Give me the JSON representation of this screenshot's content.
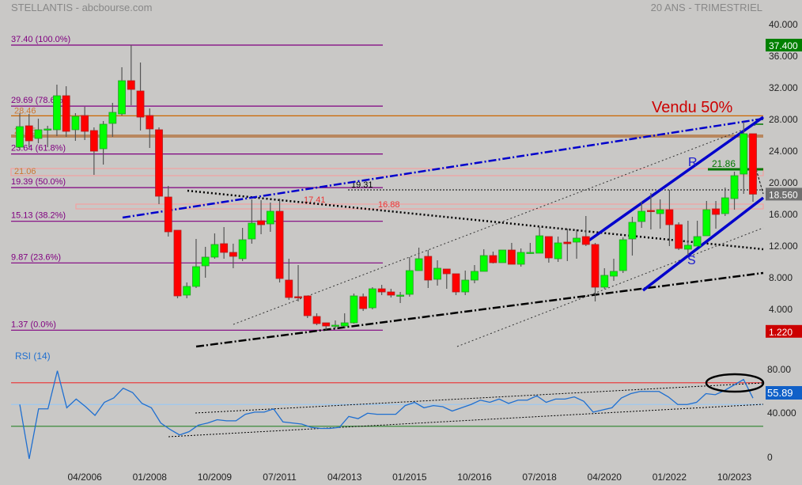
{
  "header": {
    "title": "STELLANTIS - abcbourse.com",
    "period": "20 ANS - TRIMESTRIEL"
  },
  "annotations": {
    "vendu": "Vendu 50%",
    "r": "R",
    "s": "S",
    "rsi_title": "RSI (14)"
  },
  "colors": {
    "up": "#00ff00",
    "down": "#ff0000",
    "fib": "#800080",
    "orange": "#cc6600",
    "blue": "#0000cc",
    "rsi": "#1f6fd0",
    "bg": "#c9c8c6"
  },
  "chart_data": [
    {
      "type": "candlestick",
      "title": "STELLANTIS - 20 ANS - TRIMESTRIEL",
      "ylim": [
        0,
        40
      ],
      "y_ticks": [
        "40.000",
        "36.000",
        "32.000",
        "28.000",
        "24.000",
        "20.000",
        "16.000",
        "12.000",
        "8.000",
        "4.000"
      ],
      "y_tick_values": [
        40,
        36,
        32,
        28,
        24,
        20,
        16,
        12,
        8,
        4
      ],
      "x_ticks": [
        "04/2006",
        "01/2008",
        "10/2009",
        "07/2011",
        "04/2013",
        "01/2015",
        "10/2016",
        "07/2018",
        "04/2020",
        "01/2022",
        "10/2023"
      ],
      "x_tick_index": [
        7,
        14,
        21,
        28,
        35,
        42,
        49,
        56,
        63,
        70,
        77
      ],
      "badges": [
        {
          "label": "37.400",
          "value": 37.4,
          "color": "#008000"
        },
        {
          "label": "18.560",
          "value": 18.56,
          "color": "#707070"
        },
        {
          "label": "1.220",
          "value": 1.22,
          "color": "#cc0000"
        }
      ],
      "fib_levels": [
        {
          "label": "37.40  (100.0%)",
          "value": 37.4
        },
        {
          "label": "29.69  (78.6%)",
          "value": 29.69
        },
        {
          "label": "23.64  (61.8%)",
          "value": 23.64
        },
        {
          "label": "19.39  (50.0%)",
          "value": 19.39
        },
        {
          "label": "15.13  (38.2%)",
          "value": 15.13
        },
        {
          "label": "9.87  (23.6%)",
          "value": 9.87
        },
        {
          "label": "1.37  (0.0%)",
          "value": 1.37
        }
      ],
      "levels": [
        {
          "label": "28.46",
          "value": 28.46
        },
        {
          "label": "26.15",
          "value": 26.15
        },
        {
          "label": "21.06",
          "value": 21.06
        },
        {
          "label": "19.31",
          "value": 19.31
        },
        {
          "label": "17.41",
          "value": 17.41
        },
        {
          "label": "16.88",
          "value": 16.88
        },
        {
          "label": "21.86",
          "value": 21.86
        }
      ],
      "ohlc": [
        [
          24.5,
          28.8,
          24.1,
          27.1
        ],
        [
          27.2,
          28.7,
          24.5,
          25.3
        ],
        [
          25.6,
          28.1,
          25.0,
          26.7
        ],
        [
          26.7,
          27.2,
          24.5,
          26.8
        ],
        [
          26.7,
          32.4,
          25.9,
          31.0
        ],
        [
          31.0,
          32.2,
          25.8,
          26.5
        ],
        [
          26.7,
          28.8,
          25.3,
          28.4
        ],
        [
          28.5,
          29.6,
          25.4,
          26.5
        ],
        [
          26.6,
          27.0,
          21.0,
          24.0
        ],
        [
          24.3,
          27.8,
          22.3,
          27.4
        ],
        [
          27.5,
          30.1,
          25.8,
          28.9
        ],
        [
          28.7,
          34.6,
          28.5,
          32.9
        ],
        [
          32.9,
          37.4,
          29.8,
          31.8
        ],
        [
          31.6,
          35.2,
          26.6,
          28.3
        ],
        [
          28.5,
          29.4,
          24.4,
          26.8
        ],
        [
          26.7,
          27.0,
          17.3,
          18.3
        ],
        [
          18.2,
          19.6,
          13.2,
          13.8
        ],
        [
          14.0,
          14.0,
          5.4,
          5.7
        ],
        [
          5.8,
          7.4,
          5.4,
          6.9
        ],
        [
          6.9,
          12.9,
          6.7,
          9.4
        ],
        [
          9.5,
          11.9,
          8.0,
          10.6
        ],
        [
          10.6,
          13.6,
          10.4,
          12.2
        ],
        [
          12.3,
          14.4,
          10.4,
          11.2
        ],
        [
          11.2,
          12.3,
          9.2,
          10.7
        ],
        [
          10.4,
          14.3,
          10.1,
          12.8
        ],
        [
          12.9,
          17.9,
          12.3,
          14.9
        ],
        [
          15.2,
          17.8,
          13.5,
          14.7
        ],
        [
          14.8,
          17.5,
          13.8,
          16.4
        ],
        [
          16.4,
          18.0,
          7.4,
          7.9
        ],
        [
          7.7,
          10.4,
          5.2,
          5.5
        ],
        [
          5.6,
          9.6,
          5.0,
          5.5
        ],
        [
          5.7,
          5.7,
          2.9,
          3.2
        ],
        [
          3.1,
          3.5,
          2.0,
          2.2
        ],
        [
          2.3,
          2.3,
          1.4,
          1.9
        ],
        [
          1.9,
          2.6,
          1.6,
          2.0
        ],
        [
          1.9,
          3.5,
          1.7,
          2.3
        ],
        [
          2.3,
          6.0,
          2.2,
          5.7
        ],
        [
          5.6,
          6.0,
          3.8,
          4.1
        ],
        [
          4.2,
          6.8,
          4.0,
          6.6
        ],
        [
          6.6,
          7.1,
          5.8,
          6.2
        ],
        [
          6.2,
          6.6,
          5.5,
          5.8
        ],
        [
          5.8,
          6.2,
          4.8,
          5.8
        ],
        [
          5.9,
          10.6,
          5.6,
          8.9
        ],
        [
          8.9,
          11.8,
          8.9,
          10.4
        ],
        [
          10.7,
          11.5,
          6.7,
          7.7
        ],
        [
          7.8,
          10.2,
          7.0,
          9.2
        ],
        [
          9.1,
          9.1,
          6.6,
          8.5
        ],
        [
          8.5,
          8.5,
          5.8,
          6.2
        ],
        [
          6.2,
          8.9,
          5.8,
          7.7
        ],
        [
          7.7,
          9.6,
          7.3,
          8.8
        ],
        [
          8.8,
          11.6,
          8.8,
          10.8
        ],
        [
          10.8,
          11.3,
          9.8,
          9.9
        ],
        [
          9.9,
          11.5,
          9.9,
          11.5
        ],
        [
          11.5,
          12.4,
          9.7,
          9.7
        ],
        [
          9.7,
          11.7,
          9.4,
          11.2
        ],
        [
          11.1,
          12.4,
          11.0,
          11.2
        ],
        [
          11.1,
          14.4,
          11.1,
          13.3
        ],
        [
          13.2,
          13.2,
          9.9,
          10.5
        ],
        [
          10.4,
          13.2,
          10.0,
          12.4
        ],
        [
          12.5,
          14.2,
          10.1,
          12.3
        ],
        [
          12.5,
          14.1,
          10.4,
          13.0
        ],
        [
          13.2,
          15.8,
          12.0,
          12.2
        ],
        [
          12.2,
          12.4,
          5.0,
          6.8
        ],
        [
          6.8,
          9.2,
          6.6,
          8.3
        ],
        [
          8.2,
          10.4,
          7.6,
          8.8
        ],
        [
          8.9,
          13.1,
          8.6,
          12.8
        ],
        [
          12.9,
          15.7,
          10.8,
          15.0
        ],
        [
          15.1,
          17.6,
          14.3,
          16.4
        ],
        [
          16.5,
          18.7,
          14.1,
          16.4
        ],
        [
          16.1,
          17.9,
          14.2,
          16.6
        ],
        [
          16.6,
          19.1,
          12.0,
          14.7
        ],
        [
          14.7,
          15.0,
          11.5,
          11.7
        ],
        [
          11.6,
          15.2,
          10.8,
          12.1
        ],
        [
          12.0,
          15.2,
          12.0,
          13.2
        ],
        [
          13.3,
          17.7,
          13.3,
          16.6
        ],
        [
          16.7,
          17.7,
          14.2,
          16.0
        ],
        [
          16.1,
          19.4,
          15.8,
          18.1
        ],
        [
          18.0,
          21.4,
          16.6,
          20.9
        ],
        [
          21.1,
          27.7,
          18.6,
          26.2
        ],
        [
          26.2,
          26.2,
          17.6,
          18.56
        ]
      ]
    },
    {
      "type": "line",
      "title": "RSI (14)",
      "ylim": [
        0,
        100
      ],
      "y_ticks": [
        "80.00",
        "40.000",
        "0"
      ],
      "y_tick_values": [
        80,
        40,
        0
      ],
      "hlines": [
        70,
        50,
        30
      ],
      "last_value_label": "55.89",
      "values": [
        50,
        0,
        46,
        46,
        81,
        47,
        55,
        48,
        40,
        52,
        56,
        65,
        61,
        51,
        47,
        33,
        27,
        22,
        25,
        31,
        33,
        36,
        35,
        35,
        41,
        43,
        43,
        46,
        34,
        33,
        32,
        29,
        28,
        28,
        29,
        39,
        37,
        42,
        41,
        41,
        41,
        49,
        52,
        47,
        49,
        48,
        44,
        47,
        50,
        54,
        52,
        55,
        51,
        54,
        54,
        58,
        52,
        55,
        55,
        57,
        53,
        43,
        45,
        47,
        56,
        60,
        62,
        62,
        62,
        57,
        50,
        50,
        52,
        60,
        59,
        63,
        68,
        73,
        55.89
      ]
    }
  ]
}
